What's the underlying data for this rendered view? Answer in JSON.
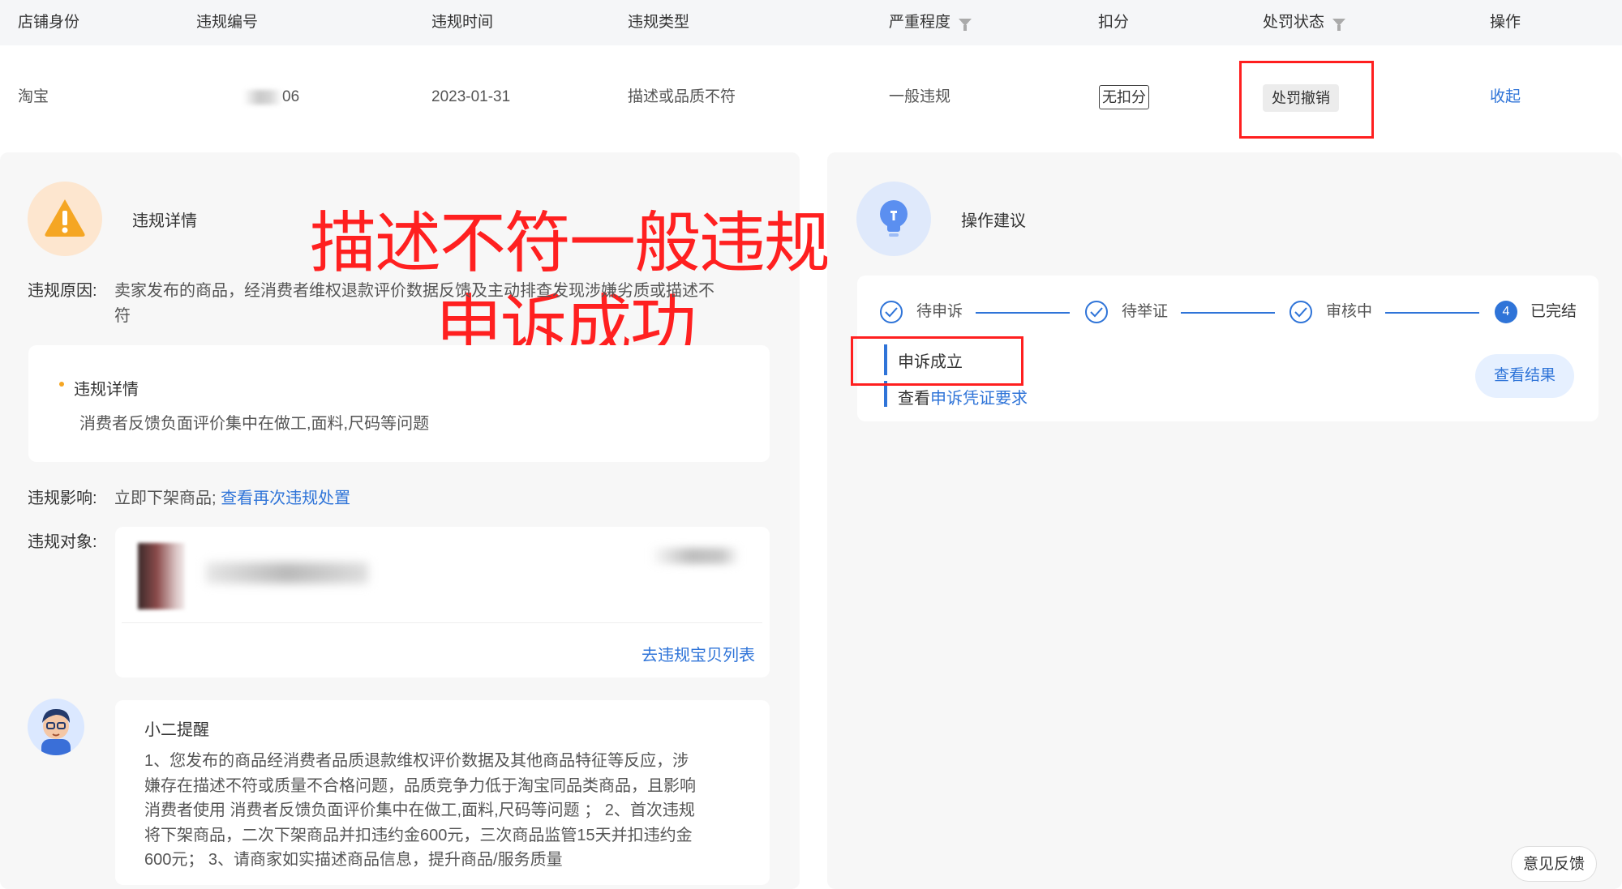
{
  "table": {
    "headers": [
      "店铺身份",
      "违规编号",
      "违规时间",
      "违规类型",
      "严重程度",
      "扣分",
      "处罚状态",
      "操作"
    ],
    "row": {
      "shop_identity": "淘宝",
      "violation_id_suffix": "06",
      "violation_time": "2023-01-31",
      "violation_type": "描述或品质不符",
      "severity": "一般违规",
      "points": "无扣分",
      "penalty_status": "处罚撤销",
      "action": "收起"
    }
  },
  "violation_detail": {
    "title": "违规详情",
    "reason_label": "违规原因:",
    "reason_text_line1": "卖家发布的商品，经消费者维权退款评价数据反馈及主动排查发现涉嫌劣质或描述不",
    "reason_text_line2": "符",
    "sub_title": "违规详情",
    "sub_text": "消费者反馈负面评价集中在做工,面料,尺码等问题",
    "impact_label": "违规影响:",
    "impact_text": "立即下架商品;",
    "impact_link": "查看再次违规处置",
    "object_label": "违规对象:",
    "object_link": "去违规宝贝列表"
  },
  "overlay_annotation": {
    "line1": "描述不符一般违规",
    "line2": "申诉成功"
  },
  "reminder": {
    "title": "小二提醒",
    "lines": [
      "1、您发布的商品经消费者品质退款维权评价数据及其他商品特征等反应，涉",
      "嫌存在描述不符或质量不合格问题，品质竞争力低于淘宝同品类商品，且影响",
      "消费者使用 消费者反馈负面评价集中在做工,面料,尺码等问题 ； 2、首次违规",
      "将下架商品，二次下架商品并扣违约金600元，三次商品监管15天并扣违约金",
      "600元； 3、请商家如实描述商品信息，提升商品/服务质量"
    ]
  },
  "suggestion": {
    "title": "操作建议",
    "steps": [
      "待申诉",
      "待举证",
      "审核中",
      "已完结"
    ],
    "current_step_number": "4",
    "result_title": "申诉成立",
    "result_prefix": "查看",
    "result_link": "申诉凭证要求",
    "result_button": "查看结果"
  },
  "feedback_button": "意见反馈",
  "colors": {
    "accent_blue": "#2f74d8",
    "annotation_red": "#ff2020",
    "warning_orange": "#f5a623"
  }
}
